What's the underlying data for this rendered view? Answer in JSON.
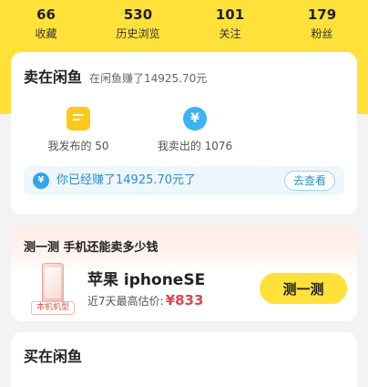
{
  "stats": [
    {
      "value": "66",
      "label": "收藏"
    },
    {
      "value": "530",
      "label": "历史浏览"
    },
    {
      "value": "101",
      "label": "关注"
    },
    {
      "value": "179",
      "label": "粉丝"
    }
  ],
  "sell": {
    "title": "卖在闲鱼",
    "subtitle": "在闲鱼赚了14925.70元",
    "published": {
      "label": "我发布的 50",
      "icon": "document-icon"
    },
    "sold": {
      "label": "我卖出的 1076",
      "icon": "yen-icon",
      "glyph": "¥"
    },
    "earn": {
      "glyph": "¥",
      "text": "你已经赚了14925.70元了",
      "button": "去查看"
    }
  },
  "phone": {
    "header": "测一测 手机还能卖多少钱",
    "tag": "本机机型",
    "name": "苹果 iphoneSE",
    "price_label": "近7天最高估价:",
    "price": "¥833",
    "button": "测一测"
  },
  "buy": {
    "title": "买在闲鱼"
  },
  "colors": {
    "brand_yellow": "#ffe13a",
    "accent_blue": "#2fa6ec",
    "price_red": "#e0424b"
  }
}
